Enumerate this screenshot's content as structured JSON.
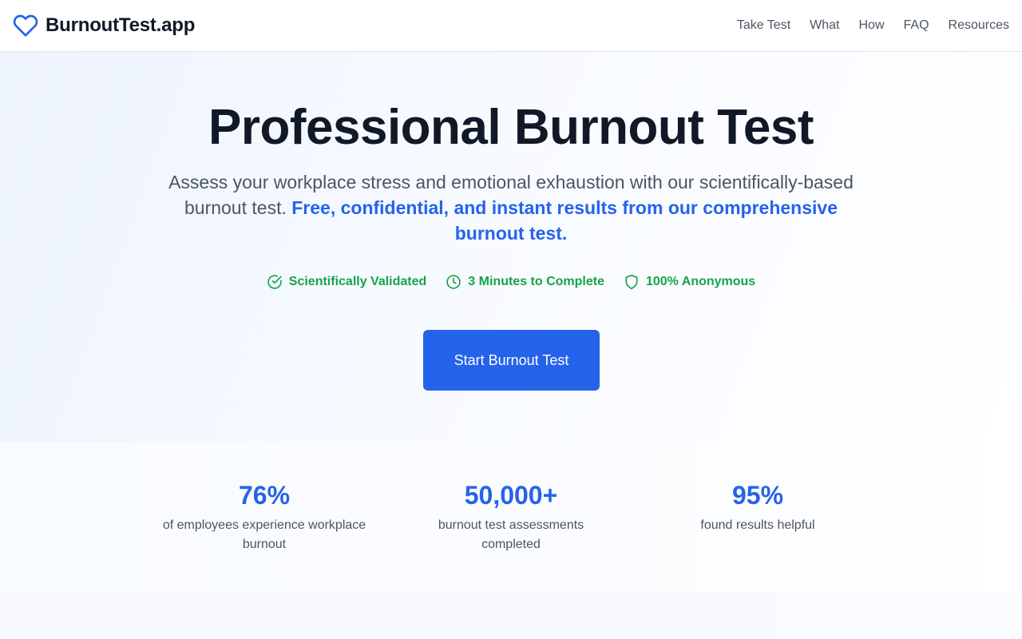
{
  "header": {
    "brand": "BurnoutTest.app",
    "nav": [
      "Take Test",
      "What",
      "How",
      "FAQ",
      "Resources"
    ]
  },
  "hero": {
    "title": "Professional Burnout Test",
    "subtitle": "Assess your workplace stress and emotional exhaustion with our scientifically-based burnout test.",
    "highlight": "Free, confidential, and instant results from our comprehensive burnout test.",
    "badges": [
      {
        "icon": "check-circle-icon",
        "label": "Scientifically Validated"
      },
      {
        "icon": "clock-icon",
        "label": "3 Minutes to Complete"
      },
      {
        "icon": "shield-icon",
        "label": "100% Anonymous"
      }
    ],
    "cta": "Start Burnout Test"
  },
  "stats": [
    {
      "value": "76%",
      "label": "of employees experience workplace burnout"
    },
    {
      "value": "50,000+",
      "label": "burnout test assessments completed"
    },
    {
      "value": "95%",
      "label": "found results helpful"
    }
  ],
  "colors": {
    "accent": "#2563eb",
    "success": "#16a34a",
    "text": "#111827",
    "muted": "#4b5563"
  }
}
